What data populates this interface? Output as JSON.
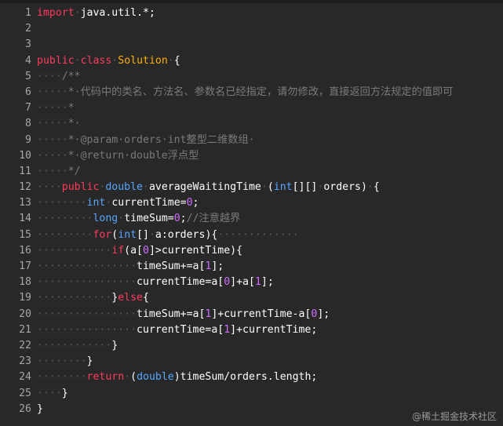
{
  "colors": {
    "background": "#282828",
    "line_number": "#a6a6a6",
    "whitespace_dots": "#5a5a5a",
    "keyword": "#ff3b5c",
    "class_name": "#ffb000",
    "comment": "#7a7a7a",
    "type": "#56a6ff",
    "number": "#cf6bff",
    "text": "#e6e6e6"
  },
  "lines": [
    {
      "no": "1",
      "tokens": [
        {
          "t": "import",
          "c": "kw"
        },
        {
          "t": "·",
          "c": "ws"
        },
        {
          "t": "java.util.*;",
          "c": "id"
        }
      ]
    },
    {
      "no": "2",
      "tokens": []
    },
    {
      "no": "3",
      "tokens": []
    },
    {
      "no": "4",
      "tokens": [
        {
          "t": "public",
          "c": "kw"
        },
        {
          "t": "·",
          "c": "ws"
        },
        {
          "t": "class",
          "c": "kw"
        },
        {
          "t": "·",
          "c": "ws"
        },
        {
          "t": "Solution",
          "c": "cls"
        },
        {
          "t": "·",
          "c": "ws"
        },
        {
          "t": "{",
          "c": "id"
        }
      ]
    },
    {
      "no": "5",
      "tokens": [
        {
          "t": "····",
          "c": "ws"
        },
        {
          "t": "/**",
          "c": "cm"
        }
      ]
    },
    {
      "no": "6",
      "tokens": [
        {
          "t": "·····",
          "c": "ws"
        },
        {
          "t": "*·代码中的类名、方法名、参数名已经指定，请勿修改，直接返回方法规定的值即可",
          "c": "cm"
        }
      ]
    },
    {
      "no": "7",
      "tokens": [
        {
          "t": "·····",
          "c": "ws"
        },
        {
          "t": "*",
          "c": "cm"
        }
      ]
    },
    {
      "no": "8",
      "tokens": [
        {
          "t": "·····",
          "c": "ws"
        },
        {
          "t": "*·",
          "c": "cm"
        }
      ]
    },
    {
      "no": "9",
      "tokens": [
        {
          "t": "·····",
          "c": "ws"
        },
        {
          "t": "*·@param·orders·int整型二维数组·",
          "c": "cm"
        }
      ]
    },
    {
      "no": "10",
      "tokens": [
        {
          "t": "·····",
          "c": "ws"
        },
        {
          "t": "*·@return·double浮点型",
          "c": "cm"
        }
      ]
    },
    {
      "no": "11",
      "tokens": [
        {
          "t": "·····",
          "c": "ws"
        },
        {
          "t": "*/",
          "c": "cm"
        }
      ]
    },
    {
      "no": "12",
      "tokens": [
        {
          "t": "····",
          "c": "ws"
        },
        {
          "t": "public",
          "c": "kw"
        },
        {
          "t": "·",
          "c": "ws"
        },
        {
          "t": "double",
          "c": "ty"
        },
        {
          "t": "·",
          "c": "ws"
        },
        {
          "t": "averageWaitingTime",
          "c": "id"
        },
        {
          "t": "·",
          "c": "ws"
        },
        {
          "t": "(",
          "c": "id"
        },
        {
          "t": "int",
          "c": "ty"
        },
        {
          "t": "[][]",
          "c": "id"
        },
        {
          "t": "·",
          "c": "ws"
        },
        {
          "t": "orders)",
          "c": "id"
        },
        {
          "t": "·",
          "c": "ws"
        },
        {
          "t": "{",
          "c": "id"
        }
      ]
    },
    {
      "no": "13",
      "tokens": [
        {
          "t": "········",
          "c": "ws"
        },
        {
          "t": "int",
          "c": "ty"
        },
        {
          "t": "·",
          "c": "ws"
        },
        {
          "t": "currentTime=",
          "c": "id"
        },
        {
          "t": "0",
          "c": "num"
        },
        {
          "t": ";",
          "c": "id"
        }
      ]
    },
    {
      "no": "14",
      "tokens": [
        {
          "t": "·········",
          "c": "ws"
        },
        {
          "t": "long",
          "c": "ty"
        },
        {
          "t": "·",
          "c": "ws"
        },
        {
          "t": "timeSum=",
          "c": "id"
        },
        {
          "t": "0",
          "c": "num"
        },
        {
          "t": ";",
          "c": "id"
        },
        {
          "t": "//注意越界",
          "c": "cm"
        }
      ]
    },
    {
      "no": "15",
      "tokens": [
        {
          "t": "·········",
          "c": "ws"
        },
        {
          "t": "for",
          "c": "kw"
        },
        {
          "t": "(",
          "c": "id"
        },
        {
          "t": "int",
          "c": "ty"
        },
        {
          "t": "[]",
          "c": "id"
        },
        {
          "t": "·",
          "c": "ws"
        },
        {
          "t": "a:orders){",
          "c": "id"
        },
        {
          "t": "·············",
          "c": "ws"
        }
      ]
    },
    {
      "no": "16",
      "tokens": [
        {
          "t": "············",
          "c": "ws"
        },
        {
          "t": "if",
          "c": "kw"
        },
        {
          "t": "(a[",
          "c": "id"
        },
        {
          "t": "0",
          "c": "num"
        },
        {
          "t": "]>currentTime){",
          "c": "id"
        }
      ]
    },
    {
      "no": "17",
      "tokens": [
        {
          "t": "················",
          "c": "ws"
        },
        {
          "t": "timeSum+=a[",
          "c": "id"
        },
        {
          "t": "1",
          "c": "num"
        },
        {
          "t": "];",
          "c": "id"
        }
      ]
    },
    {
      "no": "18",
      "tokens": [
        {
          "t": "················",
          "c": "ws"
        },
        {
          "t": "currentTime=a[",
          "c": "id"
        },
        {
          "t": "0",
          "c": "num"
        },
        {
          "t": "]+a[",
          "c": "id"
        },
        {
          "t": "1",
          "c": "num"
        },
        {
          "t": "];",
          "c": "id"
        }
      ]
    },
    {
      "no": "19",
      "tokens": [
        {
          "t": "············",
          "c": "ws"
        },
        {
          "t": "}",
          "c": "id"
        },
        {
          "t": "else",
          "c": "kw"
        },
        {
          "t": "{",
          "c": "id"
        }
      ]
    },
    {
      "no": "20",
      "tokens": [
        {
          "t": "················",
          "c": "ws"
        },
        {
          "t": "timeSum+=a[",
          "c": "id"
        },
        {
          "t": "1",
          "c": "num"
        },
        {
          "t": "]+currentTime-a[",
          "c": "id"
        },
        {
          "t": "0",
          "c": "num"
        },
        {
          "t": "];",
          "c": "id"
        }
      ]
    },
    {
      "no": "21",
      "tokens": [
        {
          "t": "················",
          "c": "ws"
        },
        {
          "t": "currentTime=a[",
          "c": "id"
        },
        {
          "t": "1",
          "c": "num"
        },
        {
          "t": "]+currentTime;",
          "c": "id"
        }
      ]
    },
    {
      "no": "22",
      "tokens": [
        {
          "t": "············",
          "c": "ws"
        },
        {
          "t": "}",
          "c": "id"
        }
      ]
    },
    {
      "no": "23",
      "tokens": [
        {
          "t": "········",
          "c": "ws"
        },
        {
          "t": "}",
          "c": "id"
        }
      ]
    },
    {
      "no": "24",
      "tokens": [
        {
          "t": "········",
          "c": "ws"
        },
        {
          "t": "return",
          "c": "kw"
        },
        {
          "t": "·",
          "c": "ws"
        },
        {
          "t": "(",
          "c": "id"
        },
        {
          "t": "double",
          "c": "ty"
        },
        {
          "t": ")timeSum/orders.length;",
          "c": "id"
        }
      ]
    },
    {
      "no": "25",
      "tokens": [
        {
          "t": "····",
          "c": "ws"
        },
        {
          "t": "}",
          "c": "id"
        }
      ]
    },
    {
      "no": "26",
      "tokens": [
        {
          "t": "}",
          "c": "id"
        }
      ]
    }
  ],
  "watermark": "@稀土掘金技术社区"
}
